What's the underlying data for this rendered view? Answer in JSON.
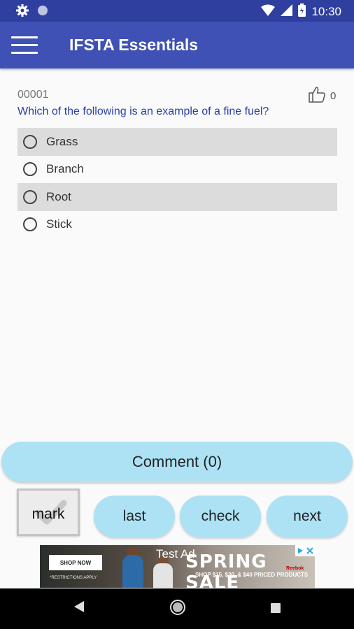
{
  "status_bar": {
    "time": "10:30"
  },
  "app_bar": {
    "title": "IFSTA Essentials"
  },
  "question": {
    "id": "00001",
    "likes": "0",
    "text": "Which of the following is an example of a fine fuel?",
    "options": [
      "Grass",
      "Branch",
      "Root",
      "Stick"
    ]
  },
  "buttons": {
    "comment": "Comment (0)",
    "mark": "mark",
    "last": "last",
    "check": "check",
    "next": "next"
  },
  "ad": {
    "label": "Test Ad",
    "headline": "SPRING SALE",
    "subline": "SHOP $15, $30, & $40 PRICED PRODUCTS",
    "shop_button": "SHOP NOW",
    "tag": "*RESTRICTIONS APPLY",
    "brand": "Reebok"
  },
  "colors": {
    "status_bar": "#2f3f9f",
    "app_bar": "#3f51b5",
    "question_text": "#2a3fa8",
    "button_bg": "#ade2f5"
  }
}
